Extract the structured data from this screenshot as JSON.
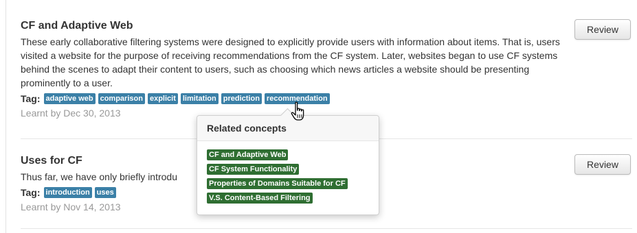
{
  "items": [
    {
      "title": "CF and Adaptive Web",
      "description": "These early collaborative filtering systems were designed to explicitly provide users with information about items. That is, users visited a website for the purpose of receiving recommendations from the CF system. Later, websites began to use CF systems behind the scenes to adapt their content to users, such as choosing which news articles a website should be presenting prominently to a user.",
      "tag_label": "Tag:",
      "tags": [
        "adaptive web",
        "comparison",
        "explicit",
        "limitation",
        "prediction",
        "recommendation"
      ],
      "learnt": "Learnt by Dec 30, 2013",
      "review_label": "Review"
    },
    {
      "title": "Uses for CF",
      "description": "Thus far, we have only briefly introdu",
      "tag_label": "Tag:",
      "tags": [
        "introduction",
        "uses"
      ],
      "learnt": "Learnt by Nov 14, 2013",
      "review_label": "Review"
    }
  ],
  "popover": {
    "title": "Related concepts",
    "concepts": [
      "CF and Adaptive Web",
      "CF System Functionality",
      "Properties of Domains Suitable for CF",
      "V.S. Content-Based Filtering"
    ]
  },
  "colors": {
    "tag_bg": "#3b80a7",
    "concept_bg": "#2f6e32",
    "muted_text": "#999999"
  },
  "icons": {
    "cursor": "hand-pointer-icon"
  }
}
